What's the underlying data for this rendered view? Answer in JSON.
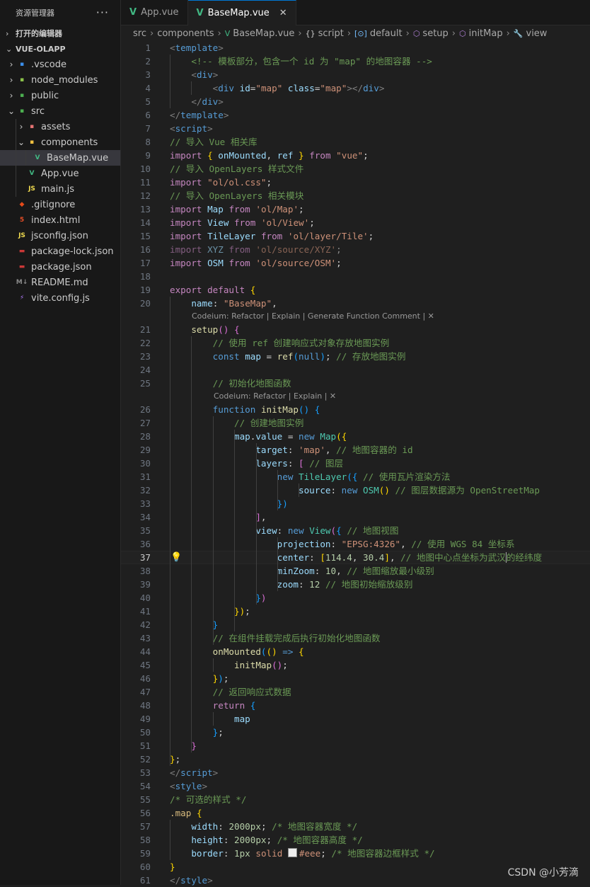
{
  "explorer": {
    "title": "资源管理器",
    "more_label": "···",
    "open_editors_label": "打开的编辑器",
    "project_label": "VUE-OLAPP",
    "tree": [
      {
        "label": ".vscode",
        "depth": 1,
        "chevron": "›",
        "icon": "folder-vscode-icon",
        "color": "#3b8eea",
        "glyph": "▪"
      },
      {
        "label": "node_modules",
        "depth": 1,
        "chevron": "›",
        "icon": "folder-node-icon",
        "color": "#8bc34a",
        "glyph": "▪"
      },
      {
        "label": "public",
        "depth": 1,
        "chevron": "›",
        "icon": "folder-public-icon",
        "color": "#4caf50",
        "glyph": "▪"
      },
      {
        "label": "src",
        "depth": 1,
        "chevron": "⌄",
        "icon": "folder-src-icon",
        "color": "#4caf50",
        "glyph": "▪"
      },
      {
        "label": "assets",
        "depth": 2,
        "chevron": "›",
        "icon": "folder-assets-icon",
        "color": "#e57373",
        "glyph": "▪"
      },
      {
        "label": "components",
        "depth": 2,
        "chevron": "⌄",
        "icon": "folder-components-icon",
        "color": "#f0c040",
        "glyph": "▪"
      },
      {
        "label": "BaseMap.vue",
        "depth": 3,
        "chevron": "",
        "icon": "vue-file-icon",
        "color": "#41b883",
        "glyph": "V",
        "active": true
      },
      {
        "label": "App.vue",
        "depth": 2,
        "chevron": "",
        "icon": "vue-file-icon",
        "color": "#41b883",
        "glyph": "V"
      },
      {
        "label": "main.js",
        "depth": 2,
        "chevron": "",
        "icon": "js-file-icon",
        "color": "#f0db4f",
        "glyph": "JS"
      },
      {
        "label": ".gitignore",
        "depth": 1,
        "chevron": "",
        "icon": "git-file-icon",
        "color": "#e64a19",
        "glyph": "◆"
      },
      {
        "label": "index.html",
        "depth": 1,
        "chevron": "",
        "icon": "html-file-icon",
        "color": "#e44d26",
        "glyph": "5"
      },
      {
        "label": "jsconfig.json",
        "depth": 1,
        "chevron": "",
        "icon": "js-file-icon",
        "color": "#f0db4f",
        "glyph": "JS"
      },
      {
        "label": "package-lock.json",
        "depth": 1,
        "chevron": "",
        "icon": "npm-file-icon",
        "color": "#cb3837",
        "glyph": "▬"
      },
      {
        "label": "package.json",
        "depth": 1,
        "chevron": "",
        "icon": "npm-file-icon",
        "color": "#cb3837",
        "glyph": "▬"
      },
      {
        "label": "README.md",
        "depth": 1,
        "chevron": "",
        "icon": "markdown-file-icon",
        "color": "#8a8a8a",
        "glyph": "M↓"
      },
      {
        "label": "vite.config.js",
        "depth": 1,
        "chevron": "",
        "icon": "vite-file-icon",
        "color": "#b47cff",
        "glyph": "⚡"
      }
    ]
  },
  "tabs": [
    {
      "label": "App.vue",
      "active": false
    },
    {
      "label": "BaseMap.vue",
      "active": true,
      "close": "✕"
    }
  ],
  "breadcrumb": [
    {
      "label": "src",
      "icon": ""
    },
    {
      "label": "components",
      "icon": ""
    },
    {
      "label": "BaseMap.vue",
      "icon": "V"
    },
    {
      "label": "script",
      "icon": "{}"
    },
    {
      "label": "default",
      "icon": "[⊙]"
    },
    {
      "label": "setup",
      "icon": "⬡"
    },
    {
      "label": "initMap",
      "icon": "⬡"
    },
    {
      "label": "view",
      "icon": "🔧"
    }
  ],
  "code_lenses": {
    "after_20": "Codeium: Refactor | Explain | Generate Function Comment | ✕",
    "after_25": "Codeium: Refactor | Explain | ✕"
  },
  "code_lines": [
    [
      [
        "t-tag",
        "<"
      ],
      [
        "t-tn",
        "template"
      ],
      [
        "t-tag",
        ">"
      ]
    ],
    [
      [
        "t-txt",
        "    "
      ],
      [
        "t-com",
        "<!-- 模板部分，包含一个 id 为 \"map\" 的地图容器 -->"
      ]
    ],
    [
      [
        "t-txt",
        "    "
      ],
      [
        "t-tag",
        "<"
      ],
      [
        "t-tn",
        "div"
      ],
      [
        "t-tag",
        ">"
      ]
    ],
    [
      [
        "t-txt",
        "        "
      ],
      [
        "t-tag",
        "<"
      ],
      [
        "t-tn",
        "div"
      ],
      [
        "t-txt",
        " "
      ],
      [
        "t-attr",
        "id"
      ],
      [
        "t-txt",
        "="
      ],
      [
        "t-str",
        "\"map\""
      ],
      [
        "t-txt",
        " "
      ],
      [
        "t-attr",
        "class"
      ],
      [
        "t-txt",
        "="
      ],
      [
        "t-str",
        "\"map\""
      ],
      [
        "t-tag",
        "></"
      ],
      [
        "t-tn",
        "div"
      ],
      [
        "t-tag",
        ">"
      ]
    ],
    [
      [
        "t-txt",
        "    "
      ],
      [
        "t-tag",
        "</"
      ],
      [
        "t-tn",
        "div"
      ],
      [
        "t-tag",
        ">"
      ]
    ],
    [
      [
        "t-tag",
        "</"
      ],
      [
        "t-tn",
        "template"
      ],
      [
        "t-tag",
        ">"
      ]
    ],
    [
      [
        "t-tag",
        "<"
      ],
      [
        "t-tn",
        "script"
      ],
      [
        "t-tag",
        ">"
      ]
    ],
    [
      [
        "t-com",
        "// 导入 Vue 相关库"
      ]
    ],
    [
      [
        "t-kw",
        "import"
      ],
      [
        "t-txt",
        " "
      ],
      [
        "t-p1",
        "{"
      ],
      [
        "t-txt",
        " "
      ],
      [
        "t-var",
        "onMounted"
      ],
      [
        "t-txt",
        ", "
      ],
      [
        "t-var",
        "ref"
      ],
      [
        "t-txt",
        " "
      ],
      [
        "t-p1",
        "}"
      ],
      [
        "t-txt",
        " "
      ],
      [
        "t-kw",
        "from"
      ],
      [
        "t-txt",
        " "
      ],
      [
        "t-str",
        "\"vue\""
      ],
      [
        "t-txt",
        ";"
      ]
    ],
    [
      [
        "t-com",
        "// 导入 OpenLayers 样式文件"
      ]
    ],
    [
      [
        "t-kw",
        "import"
      ],
      [
        "t-txt",
        " "
      ],
      [
        "t-str",
        "\"ol/ol.css\""
      ],
      [
        "t-txt",
        ";"
      ]
    ],
    [
      [
        "t-com",
        "// 导入 OpenLayers 相关模块"
      ]
    ],
    [
      [
        "t-kw",
        "import"
      ],
      [
        "t-txt",
        " "
      ],
      [
        "t-var",
        "Map"
      ],
      [
        "t-txt",
        " "
      ],
      [
        "t-kw",
        "from"
      ],
      [
        "t-txt",
        " "
      ],
      [
        "t-str",
        "'ol/Map'"
      ],
      [
        "t-txt",
        ";"
      ]
    ],
    [
      [
        "t-kw",
        "import"
      ],
      [
        "t-txt",
        " "
      ],
      [
        "t-var",
        "View"
      ],
      [
        "t-txt",
        " "
      ],
      [
        "t-kw",
        "from"
      ],
      [
        "t-txt",
        " "
      ],
      [
        "t-str",
        "'ol/View'"
      ],
      [
        "t-txt",
        ";"
      ]
    ],
    [
      [
        "t-kw",
        "import"
      ],
      [
        "t-txt",
        " "
      ],
      [
        "t-var",
        "TileLayer"
      ],
      [
        "t-txt",
        " "
      ],
      [
        "t-kw",
        "from"
      ],
      [
        "t-txt",
        " "
      ],
      [
        "t-str",
        "'ol/layer/Tile'"
      ],
      [
        "t-txt",
        ";"
      ]
    ],
    [
      [
        "t-kw t-dim",
        "import"
      ],
      [
        "t-txt",
        " "
      ],
      [
        "t-var t-dim",
        "XYZ"
      ],
      [
        "t-txt",
        " "
      ],
      [
        "t-kw t-dim",
        "from"
      ],
      [
        "t-txt",
        " "
      ],
      [
        "t-str t-dim",
        "'ol/source/XYZ'"
      ],
      [
        "t-txt t-dim",
        ";"
      ]
    ],
    [
      [
        "t-kw",
        "import"
      ],
      [
        "t-txt",
        " "
      ],
      [
        "t-var",
        "OSM"
      ],
      [
        "t-txt",
        " "
      ],
      [
        "t-kw",
        "from"
      ],
      [
        "t-txt",
        " "
      ],
      [
        "t-str",
        "'ol/source/OSM'"
      ],
      [
        "t-txt",
        ";"
      ]
    ],
    [],
    [
      [
        "t-kw",
        "export"
      ],
      [
        "t-txt",
        " "
      ],
      [
        "t-kw",
        "default"
      ],
      [
        "t-txt",
        " "
      ],
      [
        "t-p1",
        "{"
      ]
    ],
    [
      [
        "t-txt",
        "    "
      ],
      [
        "t-var",
        "name"
      ],
      [
        "t-txt",
        ": "
      ],
      [
        "t-str",
        "\"BaseMap\""
      ],
      [
        "t-txt",
        ","
      ]
    ],
    [
      [
        "t-txt",
        "    "
      ],
      [
        "t-fn",
        "setup"
      ],
      [
        "t-p2",
        "()"
      ],
      [
        "t-txt",
        " "
      ],
      [
        "t-p2",
        "{"
      ]
    ],
    [
      [
        "t-txt",
        "        "
      ],
      [
        "t-com",
        "// 使用 ref 创建响应式对象存放地图实例"
      ]
    ],
    [
      [
        "t-txt",
        "        "
      ],
      [
        "t-kw2",
        "const"
      ],
      [
        "t-txt",
        " "
      ],
      [
        "t-var",
        "map"
      ],
      [
        "t-txt",
        " = "
      ],
      [
        "t-fn",
        "ref"
      ],
      [
        "t-p3",
        "("
      ],
      [
        "t-kw2",
        "null"
      ],
      [
        "t-p3",
        ")"
      ],
      [
        "t-txt",
        "; "
      ],
      [
        "t-com",
        "// 存放地图实例"
      ]
    ],
    [],
    [
      [
        "t-txt",
        "        "
      ],
      [
        "t-com",
        "// 初始化地图函数"
      ]
    ],
    [
      [
        "t-txt",
        "        "
      ],
      [
        "t-kw2",
        "function"
      ],
      [
        "t-txt",
        " "
      ],
      [
        "t-fn",
        "initMap"
      ],
      [
        "t-p3",
        "()"
      ],
      [
        "t-txt",
        " "
      ],
      [
        "t-p3",
        "{"
      ]
    ],
    [
      [
        "t-txt",
        "            "
      ],
      [
        "t-com",
        "// 创建地图实例"
      ]
    ],
    [
      [
        "t-txt",
        "            "
      ],
      [
        "t-var",
        "map"
      ],
      [
        "t-txt",
        "."
      ],
      [
        "t-var",
        "value"
      ],
      [
        "t-txt",
        " = "
      ],
      [
        "t-kw2",
        "new"
      ],
      [
        "t-txt",
        " "
      ],
      [
        "t-cls",
        "Map"
      ],
      [
        "t-p1",
        "({"
      ]
    ],
    [
      [
        "t-txt",
        "                "
      ],
      [
        "t-var",
        "target"
      ],
      [
        "t-txt",
        ": "
      ],
      [
        "t-str",
        "'map'"
      ],
      [
        "t-txt",
        ", "
      ],
      [
        "t-com",
        "// 地图容器的 id"
      ]
    ],
    [
      [
        "t-txt",
        "                "
      ],
      [
        "t-var",
        "layers"
      ],
      [
        "t-txt",
        ": "
      ],
      [
        "t-p2",
        "["
      ],
      [
        "t-txt",
        " "
      ],
      [
        "t-com",
        "// 图层"
      ]
    ],
    [
      [
        "t-txt",
        "                    "
      ],
      [
        "t-kw2",
        "new"
      ],
      [
        "t-txt",
        " "
      ],
      [
        "t-cls",
        "TileLayer"
      ],
      [
        "t-p3",
        "({"
      ],
      [
        "t-txt",
        " "
      ],
      [
        "t-com",
        "// 使用瓦片渲染方法"
      ]
    ],
    [
      [
        "t-txt",
        "                        "
      ],
      [
        "t-var",
        "source"
      ],
      [
        "t-txt",
        ": "
      ],
      [
        "t-kw2",
        "new"
      ],
      [
        "t-txt",
        " "
      ],
      [
        "t-cls",
        "OSM"
      ],
      [
        "t-p1",
        "()"
      ],
      [
        "t-txt",
        " "
      ],
      [
        "t-com",
        "// 图层数据源为 OpenStreetMap"
      ]
    ],
    [
      [
        "t-txt",
        "                    "
      ],
      [
        "t-p3",
        "})"
      ]
    ],
    [
      [
        "t-txt",
        "                "
      ],
      [
        "t-p2",
        "]"
      ],
      [
        "t-txt",
        ","
      ]
    ],
    [
      [
        "t-txt",
        "                "
      ],
      [
        "t-var",
        "view"
      ],
      [
        "t-txt",
        ": "
      ],
      [
        "t-kw2",
        "new"
      ],
      [
        "t-txt",
        " "
      ],
      [
        "t-cls",
        "View"
      ],
      [
        "t-p2",
        "("
      ],
      [
        "t-p3",
        "{"
      ],
      [
        "t-txt",
        " "
      ],
      [
        "t-com",
        "// 地图视图"
      ]
    ],
    [
      [
        "t-txt",
        "                    "
      ],
      [
        "t-var",
        "projection"
      ],
      [
        "t-txt",
        ": "
      ],
      [
        "t-str",
        "\"EPSG:4326\""
      ],
      [
        "t-txt",
        ", "
      ],
      [
        "t-com",
        "// 使用 WGS 84 坐标系"
      ]
    ],
    [
      [
        "t-txt",
        "                    "
      ],
      [
        "t-var",
        "center"
      ],
      [
        "t-txt",
        ": "
      ],
      [
        "t-p1",
        "["
      ],
      [
        "t-num",
        "114.4"
      ],
      [
        "t-txt",
        ", "
      ],
      [
        "t-num",
        "30.4"
      ],
      [
        "t-p1",
        "]"
      ],
      [
        "t-txt",
        ", "
      ],
      [
        "t-com",
        "// 地图中心点坐标为武汉"
      ],
      [
        "cursor",
        ""
      ],
      [
        "t-com",
        "的经纬度"
      ]
    ],
    [
      [
        "t-txt",
        "                    "
      ],
      [
        "t-var",
        "minZoom"
      ],
      [
        "t-txt",
        ": "
      ],
      [
        "t-num",
        "10"
      ],
      [
        "t-txt",
        ", "
      ],
      [
        "t-com",
        "// 地图缩放最小级别"
      ]
    ],
    [
      [
        "t-txt",
        "                    "
      ],
      [
        "t-var",
        "zoom"
      ],
      [
        "t-txt",
        ": "
      ],
      [
        "t-num",
        "12"
      ],
      [
        "t-txt",
        " "
      ],
      [
        "t-com",
        "// 地图初始缩放级别"
      ]
    ],
    [
      [
        "t-txt",
        "                "
      ],
      [
        "t-p3",
        "}"
      ],
      [
        "t-p2",
        ")"
      ]
    ],
    [
      [
        "t-txt",
        "            "
      ],
      [
        "t-p1",
        "})"
      ],
      [
        "t-txt",
        ";"
      ]
    ],
    [
      [
        "t-txt",
        "        "
      ],
      [
        "t-p3",
        "}"
      ]
    ],
    [
      [
        "t-txt",
        "        "
      ],
      [
        "t-com",
        "// 在组件挂载完成后执行初始化地图函数"
      ]
    ],
    [
      [
        "t-txt",
        "        "
      ],
      [
        "t-fn",
        "onMounted"
      ],
      [
        "t-p3",
        "("
      ],
      [
        "t-p1",
        "()"
      ],
      [
        "t-txt",
        " "
      ],
      [
        "t-kw2",
        "=>"
      ],
      [
        "t-txt",
        " "
      ],
      [
        "t-p1",
        "{"
      ]
    ],
    [
      [
        "t-txt",
        "            "
      ],
      [
        "t-fn",
        "initMap"
      ],
      [
        "t-p2",
        "()"
      ],
      [
        "t-txt",
        ";"
      ]
    ],
    [
      [
        "t-txt",
        "        "
      ],
      [
        "t-p1",
        "}"
      ],
      [
        "t-p3",
        ")"
      ],
      [
        "t-txt",
        ";"
      ]
    ],
    [
      [
        "t-txt",
        "        "
      ],
      [
        "t-com",
        "// 返回响应式数据"
      ]
    ],
    [
      [
        "t-txt",
        "        "
      ],
      [
        "t-kw",
        "return"
      ],
      [
        "t-txt",
        " "
      ],
      [
        "t-p3",
        "{"
      ]
    ],
    [
      [
        "t-txt",
        "            "
      ],
      [
        "t-var",
        "map"
      ]
    ],
    [
      [
        "t-txt",
        "        "
      ],
      [
        "t-p3",
        "}"
      ],
      [
        "t-txt",
        ";"
      ]
    ],
    [
      [
        "t-txt",
        "    "
      ],
      [
        "t-p2",
        "}"
      ]
    ],
    [
      [
        "t-p1",
        "}"
      ],
      [
        "t-txt",
        ";"
      ]
    ],
    [
      [
        "t-tag",
        "</"
      ],
      [
        "t-tn",
        "script"
      ],
      [
        "t-tag",
        ">"
      ]
    ],
    [
      [
        "t-tag",
        "<"
      ],
      [
        "t-tn",
        "style"
      ],
      [
        "t-tag",
        ">"
      ]
    ],
    [
      [
        "t-com",
        "/* 可选的样式 */"
      ]
    ],
    [
      [
        "t-css",
        ".map"
      ],
      [
        "t-txt",
        " "
      ],
      [
        "t-p1",
        "{"
      ]
    ],
    [
      [
        "t-txt",
        "    "
      ],
      [
        "t-prop",
        "width"
      ],
      [
        "t-txt",
        ": "
      ],
      [
        "t-num",
        "2000px"
      ],
      [
        "t-txt",
        "; "
      ],
      [
        "t-com",
        "/* 地图容器宽度 */"
      ]
    ],
    [
      [
        "t-txt",
        "    "
      ],
      [
        "t-prop",
        "height"
      ],
      [
        "t-txt",
        ": "
      ],
      [
        "t-num",
        "2000px"
      ],
      [
        "t-txt",
        "; "
      ],
      [
        "t-com",
        "/* 地图容器高度 */"
      ]
    ],
    [
      [
        "t-txt",
        "    "
      ],
      [
        "t-prop",
        "border"
      ],
      [
        "t-txt",
        ": "
      ],
      [
        "t-num",
        "1px"
      ],
      [
        "t-txt",
        " "
      ],
      [
        "t-str",
        "solid"
      ],
      [
        "t-txt",
        " "
      ],
      [
        "swatch",
        ""
      ],
      [
        "t-str",
        "#eee"
      ],
      [
        "t-txt",
        "; "
      ],
      [
        "t-com",
        "/* 地图容器边框样式 */"
      ]
    ],
    [
      [
        "t-p1",
        "}"
      ]
    ],
    [
      [
        "t-tag",
        "</"
      ],
      [
        "t-tn",
        "style"
      ],
      [
        "t-tag",
        ">"
      ]
    ]
  ],
  "current_line": 37,
  "lightbulb_icon": "💡",
  "watermark": "CSDN @小芳滴"
}
